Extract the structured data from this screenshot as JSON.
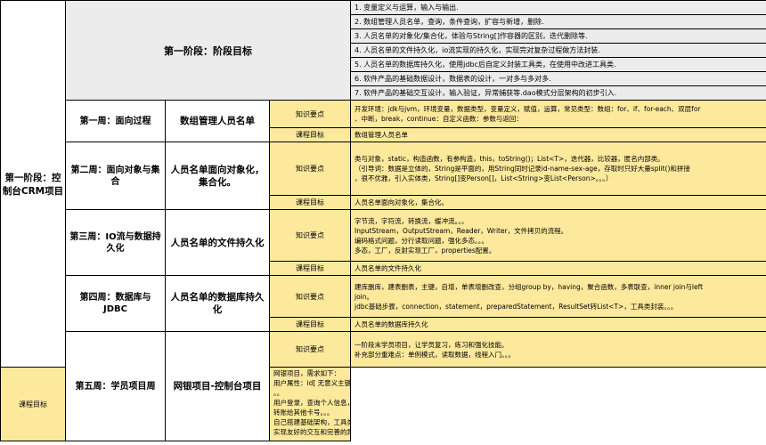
{
  "stage_left": "第一阶段：控制台CRM项目",
  "goals_header": "第一阶段：阶段目标",
  "goals": [
    "1.  变量定义与运算，输入与输出.",
    "2.  数组管理人员名单，查询，条件查询，扩容与新增，删除.",
    "3.  人员名单的对象化/集合化，体验与String[]作容器的区别，迭代删除等.",
    "4.  人员名单的文件持久化，io流实现的持久化，实现完对复杂过程做方法封装.",
    "5.  人员名单的数据库持久化，使用jdbc后自定义封装工具类，在使用中改进工具类.",
    "6.  软件产品的基础数据设计，数据表的设计，一对多与多对多.",
    "7.  软件产品的基础交互设计，输入验证，异常捕获等.dao模式分层架构的初步引入."
  ],
  "weeks": [
    {
      "title": "第一周：面向过程",
      "project": "数组管理人员名单",
      "knowledge_label": "知识要点",
      "knowledge": [
        "开发环境：jdk与jvm，环境变量，数据类型，变量定义，赋值，运算，常见类型：数组：for、if、for-each、双层for",
        "、中断，break，continue：自定义函数：参数与返回："
      ],
      "goal_label": "课程目标",
      "goal": "数组管理人员名单"
    },
    {
      "title": "第二周：面向对象与集合",
      "project": "人员名单面向对象化，集合化。",
      "knowledge_label": "知识要点",
      "knowledge": [
        "类与对象，static，构造函数，有参构造，this，toString()；List<T>，迭代器，比较器，匿名内部类。",
        "（引导词：数据是立体的，String是平面的，用String同时记录id-name-sex-age，存取时只好大量split()和拼接",
        "，很不优雅，引入实体类，String[]变Person[]，List<String>变List<Person>。。。）"
      ],
      "goal_label": "课程目标",
      "goal": "人员名单面向对象化，集合化。"
    },
    {
      "title": "第三周：IO流与数据持久化",
      "project": "人员名单的文件持久化",
      "knowledge_label": "知识要点",
      "knowledge": [
        "字节流，字符流，转换流，缓冲流。。。",
        "InputStream，OutputStream，Reader，Writer，文件拷贝的流程。",
        "编码格式问题，分行读取问题，强化多态。。。",
        "多态，工厂，反射实现工厂，properties配置。"
      ],
      "goal_label": "课程目标",
      "goal": "人员名单的文件持久化"
    },
    {
      "title": "第四周：数据库与JDBC",
      "project": "人员名单的数据库持久化",
      "knowledge_label": "知识要点",
      "knowledge": [
        "建库删库，建表删表，主键，自增，单表增删改查，分组group by，having，聚合函数，多表联查，inner join与left",
        "join。",
        "jdbc基础步骤，connection，statement，preparedStatement，ResultSet转List<T>，工具类封装。。。"
      ],
      "goal_label": "课程目标",
      "goal": "人员名单的数据库持久化"
    },
    {
      "title": "第五周：学员项目周",
      "project": "网银项目-控制台项目",
      "knowledge_label": "知识要点",
      "knowledge": [
        "一阶段末学员项目，让学员复习，练习和强化技能。",
        "补充部分重难点：单例模式，读取数据，线程入门。。。"
      ],
      "goal_label": "课程目标",
      "goal_lines": [
        "网银项目，需求如下：",
        "用户属性：id[ 无意义主键 ]，card_id[ 卡号 ]，password[ 密码 ]，realname[ 真名 ]，balance[ 余额 ]，",
        "。。",
        "用户登录，查询个人信息，包括余额。",
        "转账给其他卡号。。。",
        "自己搭建基础架构，工具类，Dao。",
        "实现友好的交互和完善的异常处理。"
      ]
    }
  ]
}
